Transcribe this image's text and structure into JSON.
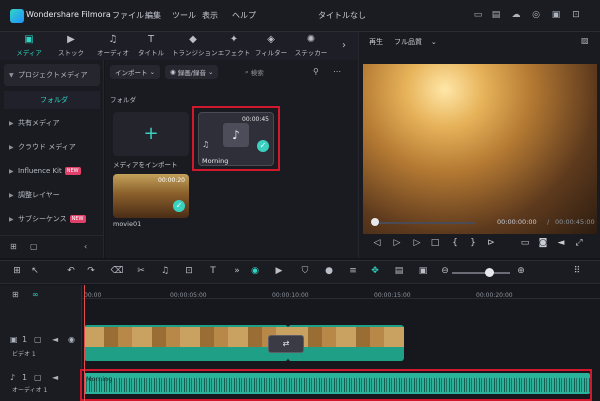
{
  "titlebar": {
    "app_name": "Wondershare Filmora",
    "menus": [
      "ファイル",
      "編集",
      "ツール",
      "表示",
      "ヘルプ"
    ],
    "project_title": "タイトルなし"
  },
  "media_toolbar": {
    "tabs": [
      {
        "label": "メディア",
        "icon": "media-icon",
        "active": true
      },
      {
        "label": "ストック",
        "icon": "stock-icon"
      },
      {
        "label": "オーディオ",
        "icon": "audio-icon"
      },
      {
        "label": "タイトル",
        "icon": "title-icon"
      },
      {
        "label": "トランジション",
        "icon": "transition-icon"
      },
      {
        "label": "エフェクト",
        "icon": "effect-icon"
      },
      {
        "label": "フィルター",
        "icon": "filter-icon"
      },
      {
        "label": "ステッカー",
        "icon": "sticker-icon"
      }
    ]
  },
  "leftnav": {
    "project_media": "プロジェクトメディア",
    "folder": "フォルダ",
    "items": [
      {
        "label": "共有メディア"
      },
      {
        "label": "クラウド メディア"
      },
      {
        "label": "Influence Kit",
        "badge": "NEW"
      },
      {
        "label": "調整レイヤー"
      },
      {
        "label": "サブシーケンス",
        "badge": "NEW"
      }
    ]
  },
  "media": {
    "import_label": "インポート",
    "record_label": "録画/録音",
    "search_placeholder": "検索",
    "folder_heading": "フォルダ",
    "import_card_label": "メディアをインポート",
    "morning": {
      "name": "Morning",
      "duration": "00:00:45"
    },
    "video": {
      "name": "movie01",
      "duration": "00:00:20"
    }
  },
  "preview": {
    "play_label": "再生",
    "quality": "フル品質",
    "current_time": "00:00:00:00",
    "separator": "/",
    "total_time": "00:00:45:00"
  },
  "timeline": {
    "ruler": [
      "00:00",
      "00:00:05:00",
      "00:00:10:00",
      "00:00:15:00",
      "00:00:20:00"
    ],
    "video_track_label": "ビデオ 1",
    "audio_track_label": "オーディオ 1",
    "audio_clip_name": "Morning",
    "track_numbers": [
      "1",
      "1"
    ]
  },
  "colors": {
    "accent": "#2fd4c3",
    "highlight": "#d2182c",
    "clip": "#2bb29a"
  }
}
